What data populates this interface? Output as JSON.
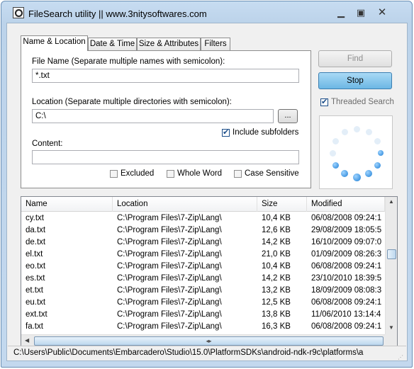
{
  "window": {
    "title": "FileSearch utility || www.3nitysoftwares.com",
    "icon": "magnifier-app-icon",
    "controls": [
      "minimize-icon",
      "maximize-icon",
      "close-icon"
    ]
  },
  "tabs": [
    {
      "label": "Name & Location",
      "active": true
    },
    {
      "label": "Date & Time",
      "active": false
    },
    {
      "label": "Size & Attributes",
      "active": false
    },
    {
      "label": "Filters",
      "active": false
    }
  ],
  "form": {
    "file_name_label": "File Name (Separate multiple names with semicolon):",
    "file_name_value": "*.txt",
    "location_label": "Location (Separate multiple directories with semicolon):",
    "location_value": "C:\\",
    "browse_label": "...",
    "include_subfolders_label": "Include subfolders",
    "include_subfolders_checked": true,
    "content_label": "Content:",
    "content_value": "",
    "excluded_label": "Excluded",
    "whole_word_label": "Whole Word",
    "case_sensitive_label": "Case Sensitive"
  },
  "actions": {
    "find_label": "Find",
    "find_enabled": false,
    "stop_label": "Stop",
    "threaded_search_label": "Threaded Search",
    "threaded_search_checked": true
  },
  "results": {
    "columns": [
      "Name",
      "Location",
      "Size",
      "Modified"
    ],
    "rows": [
      {
        "name": "cy.txt",
        "location": "C:\\Program Files\\7-Zip\\Lang\\",
        "size": "10,4 KB",
        "modified": "06/08/2008 09:24:1"
      },
      {
        "name": "da.txt",
        "location": "C:\\Program Files\\7-Zip\\Lang\\",
        "size": "12,6 KB",
        "modified": "29/08/2009 18:05:5"
      },
      {
        "name": "de.txt",
        "location": "C:\\Program Files\\7-Zip\\Lang\\",
        "size": "14,2 KB",
        "modified": "16/10/2009 09:07:0"
      },
      {
        "name": "el.txt",
        "location": "C:\\Program Files\\7-Zip\\Lang\\",
        "size": "21,0 KB",
        "modified": "01/09/2009 08:26:3"
      },
      {
        "name": "eo.txt",
        "location": "C:\\Program Files\\7-Zip\\Lang\\",
        "size": "10,4 KB",
        "modified": "06/08/2008 09:24:1"
      },
      {
        "name": "es.txt",
        "location": "C:\\Program Files\\7-Zip\\Lang\\",
        "size": "14,2 KB",
        "modified": "23/10/2010 18:39:5"
      },
      {
        "name": "et.txt",
        "location": "C:\\Program Files\\7-Zip\\Lang\\",
        "size": "13,2 KB",
        "modified": "18/09/2009 08:08:3"
      },
      {
        "name": "eu.txt",
        "location": "C:\\Program Files\\7-Zip\\Lang\\",
        "size": "12,5 KB",
        "modified": "06/08/2008 09:24:1"
      },
      {
        "name": "ext.txt",
        "location": "C:\\Program Files\\7-Zip\\Lang\\",
        "size": "13,8 KB",
        "modified": "11/06/2010 13:14:4"
      },
      {
        "name": "fa.txt",
        "location": "C:\\Program Files\\7-Zip\\Lang\\",
        "size": "16,3 KB",
        "modified": "06/08/2008 09:24:1"
      }
    ]
  },
  "status": {
    "path": "C:\\Users\\Public\\Documents\\Embarcadero\\Studio\\15.0\\PlatformSDKs\\android-ndk-r9c\\platforms\\a"
  },
  "colors": {
    "accent": "#6cb7e4",
    "spinner": "#1e7fd6"
  }
}
